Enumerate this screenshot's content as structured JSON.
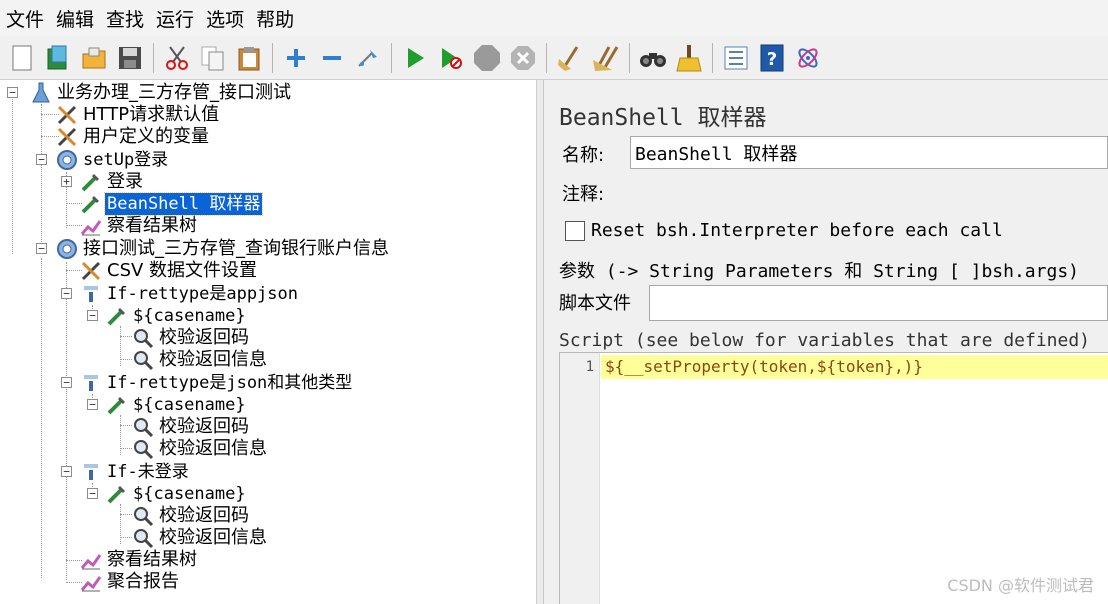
{
  "menu": [
    "文件",
    "编辑",
    "查找",
    "运行",
    "选项",
    "帮助"
  ],
  "toolbar": {
    "icons": [
      "new-icon",
      "templates-icon",
      "open-icon",
      "save-icon",
      "cut-icon",
      "copy-icon",
      "paste-icon",
      "expand-icon",
      "collapse-icon",
      "toggle-icon",
      "start-icon",
      "start-no-timers-icon",
      "stop-icon",
      "shutdown-icon",
      "clear-icon",
      "clear-all-icon",
      "search-icon",
      "reset-search-icon",
      "function-helper-icon",
      "help-icon",
      "log-viewer-icon"
    ]
  },
  "tree": {
    "root": "业务办理_三方存管_接口测试",
    "http_defaults": "HTTP请求默认值",
    "user_vars": "用户定义的变量",
    "setup_group": "setUp登录",
    "login": "登录",
    "beanshell_sampler": "BeanShell 取样器",
    "view_results_1": "察看结果树",
    "test_group": "接口测试_三方存管_查询银行账户信息",
    "csv_config": "CSV 数据文件设置",
    "if_appjson": "If-rettype是appjson",
    "casename_1": "${casename}",
    "assert_code_1": "校验返回码",
    "assert_msg_1": "校验返回信息",
    "if_json_other": "If-rettype是json和其他类型",
    "casename_2": "${casename}",
    "assert_code_2": "校验返回码",
    "assert_msg_2": "校验返回信息",
    "if_not_logged": "If-未登录",
    "casename_3": "${casename}",
    "assert_code_3": "校验返回码",
    "assert_msg_3": "校验返回信息",
    "view_results_2": "察看结果树",
    "aggregate_report": "聚合报告"
  },
  "panel": {
    "title": "BeanShell 取样器",
    "name_label": "名称:",
    "name_value": "BeanShell 取样器",
    "comment_label": "注释:",
    "comment_value": "",
    "reset_label": "Reset bsh.Interpreter before each call",
    "reset_checked": false,
    "params_label": "参数 (-> String Parameters 和 String [ ]bsh.args)",
    "script_file_label": "脚本文件",
    "script_file_value": "",
    "script_label": "Script (see below for variables that are defined)",
    "line_number": "1",
    "code": "${__setProperty(token,${token},)}"
  },
  "watermark": "CSDN @软件测试君",
  "colors": {
    "selection": "#0a64d8",
    "code_highlight": "#ffff9a",
    "code_text": "#8b4513"
  }
}
